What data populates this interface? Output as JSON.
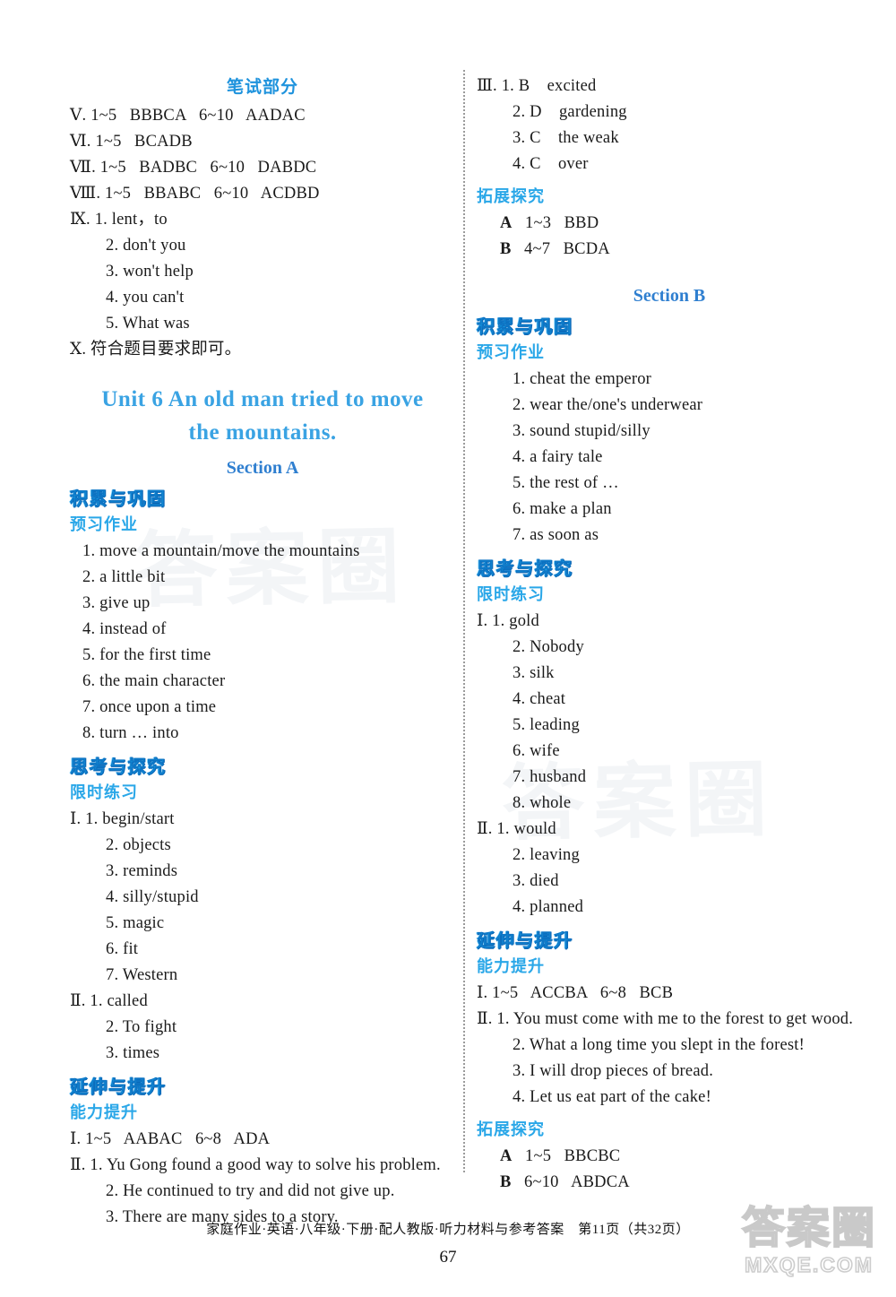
{
  "document": {
    "top_heading": "笔试部分",
    "accent_color": "#19a4e8",
    "title_color": "#3aa3e3"
  },
  "watermark": {
    "paper_text_a": "答案圈",
    "paper_text_b": "答案圈",
    "logo_cn": "答案圈",
    "logo_domain": "MXQE.COM"
  },
  "left_column": {
    "answers_top": [
      "Ⅴ. 1~5   BBBCA   6~10   AADAC",
      "Ⅵ. 1~5   BCADB",
      "Ⅶ. 1~5   BADBC   6~10   DABDC",
      "Ⅷ. 1~5   BBABC   6~10   ACDBD",
      "Ⅸ. 1. lent，to"
    ],
    "answers_ix_rest": [
      "2. don't you",
      "3. won't help",
      "4. you can't",
      "5. What was"
    ],
    "answer_x": "Ⅹ. 符合题目要求即可。",
    "unit_title_line1": "Unit 6    An old man tried to move",
    "unit_title_line2": "the mountains.",
    "section_a_label": "Section A",
    "block1": {
      "band": "积累与巩固",
      "sub": "预习作业",
      "items": [
        "1. move a mountain/move the mountains",
        "2. a little bit",
        "3. give up",
        "4. instead of",
        "5. for the first time",
        "6. the main character",
        "7. once upon a time",
        "8. turn … into"
      ]
    },
    "block2": {
      "band": "思考与探究",
      "sub": "限时练习",
      "items": [
        "Ⅰ. 1. begin/start",
        "2. objects",
        "3. reminds",
        "4. silly/stupid",
        "5. magic",
        "6. fit",
        "7. Western"
      ],
      "items2": [
        "Ⅱ. 1. called",
        "2. To fight",
        "3. times"
      ]
    },
    "block3": {
      "band": "延伸与提升",
      "sub": "能力提升",
      "line_i": "Ⅰ. 1~5   AABAC   6~8   ADA",
      "items_ii": [
        "Ⅱ. 1. Yu Gong found a good way to solve his problem.",
        "2. He continued to try and did not give up.",
        "3. There are many sides to a story."
      ]
    }
  },
  "right_column": {
    "block_iii": [
      "Ⅲ. 1. B    excited",
      "2. D    gardening",
      "3. C    the weak",
      "4. C    over"
    ],
    "tuozhan_a": {
      "sub": "拓展探究",
      "rows": [
        {
          "label": "A",
          "range": "1~3",
          "answer": "BBD"
        },
        {
          "label": "B",
          "range": "4~7",
          "answer": "BCDA"
        }
      ]
    },
    "section_b_label": "Section B",
    "block1": {
      "band": "积累与巩固",
      "sub": "预习作业",
      "items": [
        "1. cheat the emperor",
        "2. wear the/one's underwear",
        "3. sound stupid/silly",
        "4. a fairy tale",
        "5. the rest of …",
        "6. make a plan",
        "7. as soon as"
      ]
    },
    "block2": {
      "band": "思考与探究",
      "sub": "限时练习",
      "items": [
        "Ⅰ. 1. gold",
        "2. Nobody",
        "3. silk",
        "4. cheat",
        "5. leading",
        "6. wife",
        "7. husband",
        "8. whole"
      ],
      "items2": [
        "Ⅱ. 1. would",
        "2. leaving",
        "3. died",
        "4. planned"
      ]
    },
    "block3": {
      "band": "延伸与提升",
      "sub": "能力提升",
      "line_i": "Ⅰ. 1~5   ACCBA   6~8   BCB",
      "items_ii": [
        "Ⅱ. 1. You must come with me to the forest to get wood.",
        "2. What a long time you slept in the forest!",
        "3. I will drop pieces of bread.",
        "4. Let us eat part of the cake!"
      ]
    },
    "tuozhan_b": {
      "sub": "拓展探究",
      "rows": [
        {
          "label": "A",
          "range": "1~5",
          "answer": "BBCBC"
        },
        {
          "label": "B",
          "range": "6~10",
          "answer": "ABDCA"
        }
      ]
    }
  },
  "footer": {
    "text": "家庭作业·英语·八年级·下册·配人教版·听力材料与参考答案　第11页（共32页）",
    "page_number": "67"
  }
}
